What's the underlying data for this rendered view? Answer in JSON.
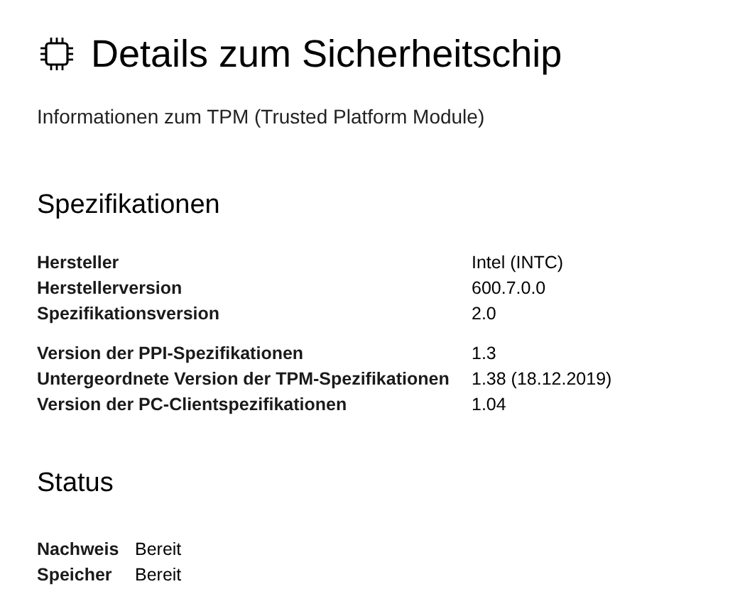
{
  "title": "Details zum Sicherheitschip",
  "subtitle": "Informationen zum TPM (Trusted Platform Module)",
  "specifications": {
    "heading": "Spezifikationen",
    "groups": [
      [
        {
          "label": "Hersteller",
          "value": "Intel (INTC)"
        },
        {
          "label": "Herstellerversion",
          "value": "600.7.0.0"
        },
        {
          "label": "Spezifikationsversion",
          "value": "2.0"
        }
      ],
      [
        {
          "label": "Version der PPI-Spezifikationen",
          "value": "1.3"
        },
        {
          "label": "Untergeordnete Version der TPM-Spezifikationen",
          "value": "1.38 (18.12.2019)"
        },
        {
          "label": "Version der PC-Clientspezifikationen",
          "value": "1.04"
        }
      ]
    ]
  },
  "status": {
    "heading": "Status",
    "rows": [
      {
        "label": "Nachweis",
        "value": "Bereit"
      },
      {
        "label": "Speicher",
        "value": "Bereit"
      }
    ]
  }
}
